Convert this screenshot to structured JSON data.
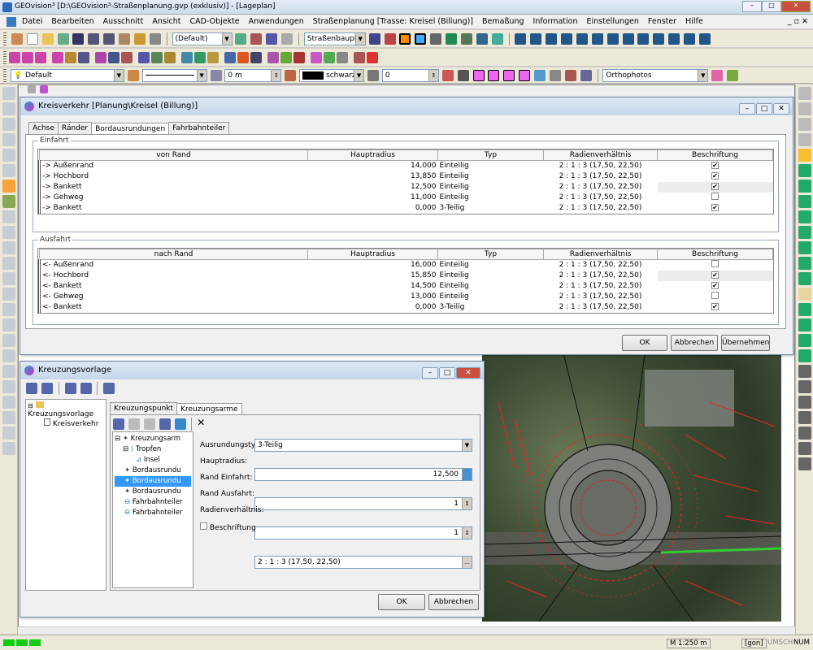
{
  "app_title": "GEOvision³  [D:\\GEOvision³-Straßenplanung.gvp (exklusiv)] - [Lageplan]",
  "menu": [
    "Datei",
    "Bearbeiten",
    "Ausschnitt",
    "Ansicht",
    "CAD-Objekte",
    "Anwendungen",
    "Straßenplanung [Trasse: Kreisel (Billung)]",
    "Bemaßung",
    "Information",
    "Einstellungen",
    "Fenster",
    "Hilfe"
  ],
  "toolbar": {
    "default_combo": "(Default)",
    "plan_combo": "Straßenbauplan",
    "layer_combo": "Default",
    "width_value": "0 m",
    "color_label": "schwarz",
    "num_value": "0",
    "ortho_combo": "Orthophotos"
  },
  "kreisverkehr": {
    "title": "Kreisverkehr [Planung\\Kreisel (Billung)]",
    "tabs": [
      "Achse",
      "Ränder",
      "Bordausrundungen",
      "Fahrbahnteiler"
    ],
    "active_tab": "Bordausrundungen",
    "einfahrt_legend": "Einfahrt",
    "ausfahrt_legend": "Ausfahrt",
    "einfahrt_headers": [
      "von Rand",
      "Hauptradius",
      "Typ",
      "Radienverhältnis",
      "Beschriftung"
    ],
    "ausfahrt_headers": [
      "nach Rand",
      "Hauptradius",
      "Typ",
      "Radienverhältnis",
      "Beschriftung"
    ],
    "einfahrt_rows": [
      {
        "rand": "-> Außenrand",
        "radius": "14,000",
        "typ": "Einteilig",
        "ratio": "2 : 1 : 3  (17,50, 22,50)",
        "checked": true
      },
      {
        "rand": "-> Hochbord",
        "radius": "13,850",
        "typ": "Einteilig",
        "ratio": "2 : 1 : 3  (17,50, 22,50)",
        "checked": true
      },
      {
        "rand": "-> Bankett",
        "radius": "12,500",
        "typ": "Einteilig",
        "ratio": "2 : 1 : 3  (17,50, 22,50)",
        "checked": true
      },
      {
        "rand": "-> Gehweg",
        "radius": "11,000",
        "typ": "Einteilig",
        "ratio": "2 : 1 : 3  (17,50, 22,50)",
        "checked": false
      },
      {
        "rand": "-> Bankett",
        "radius": "0,000",
        "typ": "3-Teilig",
        "ratio": "2 : 1 : 3  (17,50, 22,50)",
        "checked": true
      }
    ],
    "ausfahrt_rows": [
      {
        "rand": "<- Außenrand",
        "radius": "16,000",
        "typ": "Einteilig",
        "ratio": "2 : 1 : 3  (17,50, 22,50)",
        "checked": false
      },
      {
        "rand": "<- Hochbord",
        "radius": "15,850",
        "typ": "Einteilig",
        "ratio": "2 : 1 : 3  (17,50, 22,50)",
        "checked": true
      },
      {
        "rand": "<- Bankett",
        "radius": "14,500",
        "typ": "Einteilig",
        "ratio": "2 : 1 : 3  (17,50, 22,50)",
        "checked": true
      },
      {
        "rand": "<- Gehweg",
        "radius": "13,000",
        "typ": "Einteilig",
        "ratio": "2 : 1 : 3  (17,50, 22,50)",
        "checked": false
      },
      {
        "rand": "<- Bankett",
        "radius": "0,000",
        "typ": "3-Teilig",
        "ratio": "2 : 1 : 3  (17,50, 22,50)",
        "checked": true
      }
    ],
    "ok": "OK",
    "abbrechen": "Abbrechen",
    "uebernehmen": "Übernehmen"
  },
  "kreuzung": {
    "title": "Kreuzungsvorlage",
    "tree_root": "Kreuzungsvorlage",
    "tree_child": "Kreisverkehr",
    "tabs": [
      "Kreuzungspunkt",
      "Kreuzungsarme"
    ],
    "active_tab": "Kreuzungsarme",
    "subtree": {
      "root": "Kreuzungsarm",
      "tropfen": "Tropfen",
      "insel": "Insel",
      "items": [
        "Bordausrundu",
        "Bordausrundu",
        "Bordausrundu",
        "Fahrbahnteiler",
        "Fahrbahnteiler"
      ]
    },
    "props": {
      "ausrundungstyp_label": "Ausrundungstyp:",
      "ausrundungstyp_value": "3-Teilig",
      "hauptradius_label": "Hauptradius:",
      "hauptradius_value": "12,500",
      "rand_einfahrt_label": "Rand Einfahrt:",
      "rand_einfahrt_value": "1",
      "rand_ausfahrt_label": "Rand Ausfahrt:",
      "rand_ausfahrt_value": "1",
      "radienverhaeltnis_label": "Radienverhältnis:",
      "radienverhaeltnis_value": "2 : 1 : 3  (17,50, 22,50)",
      "beschriftung_label": "Beschriftung"
    },
    "ok": "OK",
    "abbrechen": "Abbrechen"
  },
  "status": {
    "scale": "M 1:250  m",
    "unit": "[gon]",
    "umsch": "UMSCH",
    "num": "NUM"
  }
}
